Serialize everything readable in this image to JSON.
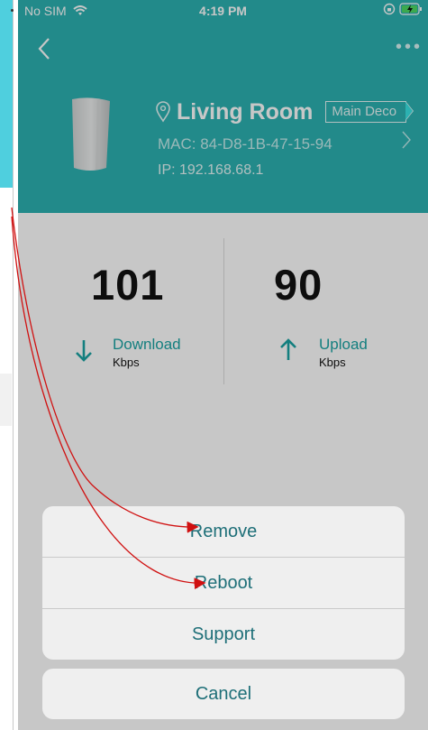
{
  "status_bar": {
    "carrier": "No SIM",
    "time": "4:19 PM"
  },
  "device": {
    "room": "Living Room",
    "badge": "Main Deco",
    "mac": "MAC: 84-D8-1B-47-15-94",
    "ip": "IP: 192.168.68.1"
  },
  "speed": {
    "download": {
      "value": "101",
      "label": "Download",
      "unit": "Kbps"
    },
    "upload": {
      "value": "90",
      "label": "Upload",
      "unit": "Kbps"
    }
  },
  "action_sheet": {
    "remove": "Remove",
    "reboot": "Reboot",
    "support": "Support",
    "cancel": "Cancel"
  },
  "colors": {
    "header_teal": "#2cb1b1",
    "accent_teal": "#1aa3a3",
    "action_text": "#1e6f78",
    "annotation_red": "#d01010"
  },
  "icons": [
    "wifi-icon",
    "back-icon",
    "more-icon",
    "location-pin-icon",
    "chevron-right-icon",
    "download-arrow-icon",
    "upload-arrow-icon",
    "battery-charging-icon",
    "orientation-lock-icon"
  ]
}
